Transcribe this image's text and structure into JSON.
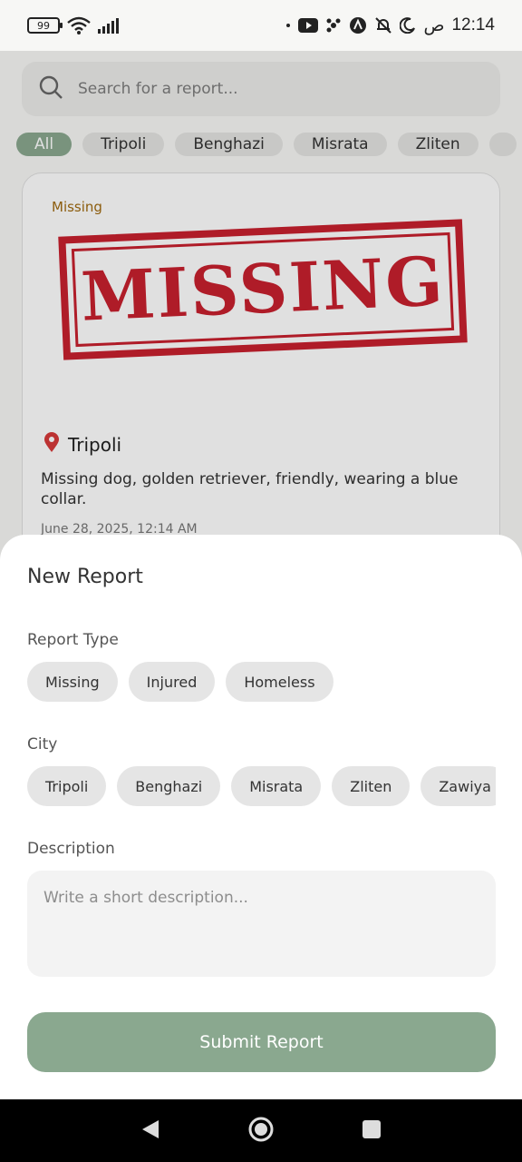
{
  "status_bar": {
    "battery": "99",
    "time": "12:14",
    "time_suffix": "ص"
  },
  "search": {
    "placeholder": "Search for a report..."
  },
  "filters": [
    "All",
    "Tripoli",
    "Benghazi",
    "Misrata",
    "Zliten"
  ],
  "card": {
    "type": "Missing",
    "stamp_text": "MISSING",
    "city": "Tripoli",
    "description": "Missing dog, golden retriever, friendly, wearing a blue collar.",
    "date": "June 28, 2025, 12:14 AM"
  },
  "sheet": {
    "title": "New Report",
    "report_type_label": "Report Type",
    "report_types": [
      "Missing",
      "Injured",
      "Homeless"
    ],
    "city_label": "City",
    "cities": [
      "Tripoli",
      "Benghazi",
      "Misrata",
      "Zliten",
      "Zawiya"
    ],
    "description_label": "Description",
    "description_placeholder": "Write a short description...",
    "submit_label": "Submit Report"
  },
  "colors": {
    "accent": "#8aa88f",
    "stamp": "#c8202e",
    "type_text": "#a06a10"
  }
}
